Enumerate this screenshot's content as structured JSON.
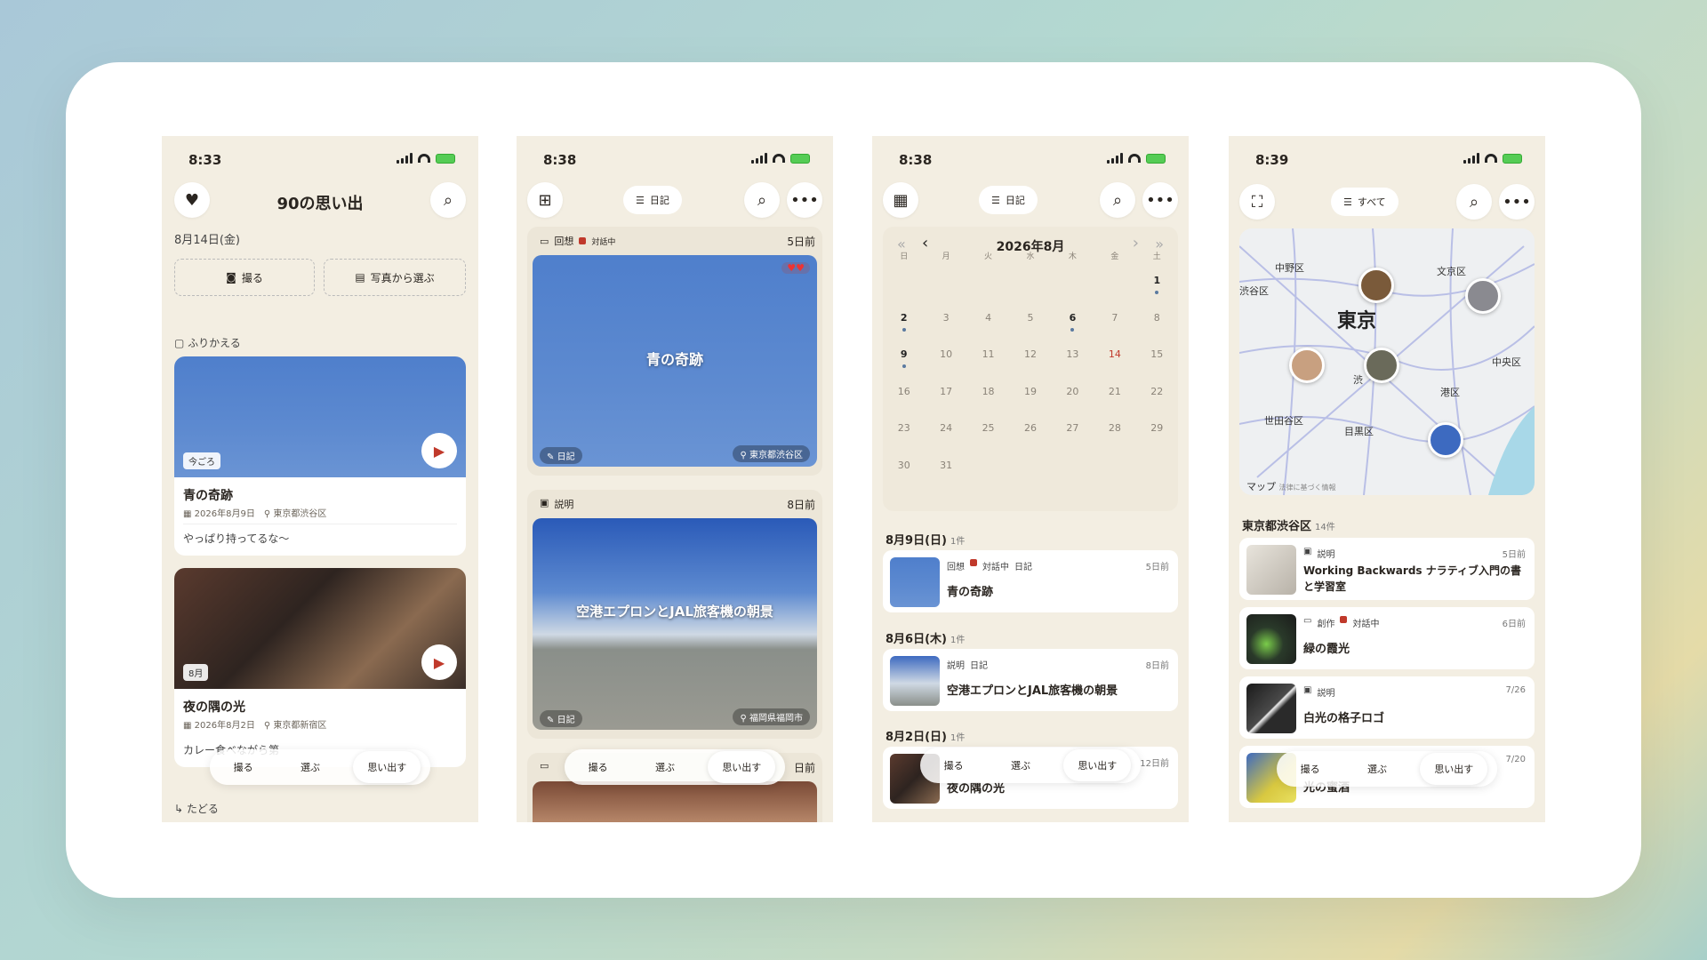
{
  "p1": {
    "time": "8:33",
    "title": "90の思い出",
    "date": "8月14日(金)",
    "btn_shoot": "撮る",
    "btn_pick": "写真から選ぶ",
    "section": "ふりかえる",
    "m1": {
      "badge": "今ごろ",
      "title": "青の奇跡",
      "date": "2026年8月9日",
      "loc": "東京都渋谷区",
      "note": "やっぱり持ってるな〜"
    },
    "m2": {
      "badge": "8月",
      "title": "夜の隅の光",
      "date": "2026年8月2日",
      "loc": "東京都新宿区",
      "note": "カレー食べながら第"
    },
    "footer": "たどる"
  },
  "tabs": {
    "shoot": "撮る",
    "pick": "選ぶ",
    "recall": "思い出す"
  },
  "p2": {
    "time": "8:38",
    "filter": "日記",
    "c1": {
      "tag1": "回想",
      "tag2": "対話中",
      "ago": "5日前",
      "title": "青の奇跡",
      "diary": "日記",
      "loc": "東京都渋谷区"
    },
    "c2": {
      "tag1": "説明",
      "ago": "8日前",
      "title": "空港エプロンとJAL旅客機の朝景",
      "diary": "日記",
      "loc": "福岡県福岡市"
    },
    "c3": {
      "ago": "日前"
    }
  },
  "p3": {
    "time": "8:38",
    "filter": "日記",
    "month": "2026年8月",
    "dow": [
      "日",
      "月",
      "火",
      "水",
      "木",
      "金",
      "土"
    ],
    "days": [
      "",
      "",
      "",
      "",
      "",
      "",
      "1",
      "2",
      "3",
      "4",
      "5",
      "6",
      "7",
      "8",
      "9",
      "10",
      "11",
      "12",
      "13",
      "14",
      "15",
      "16",
      "17",
      "18",
      "19",
      "20",
      "21",
      "22",
      "23",
      "24",
      "25",
      "26",
      "27",
      "28",
      "29",
      "30",
      "31"
    ],
    "g1": {
      "head": "8月9日(日)",
      "count": "1件",
      "t1": "回想",
      "t2": "対話中",
      "t3": "日記",
      "ago": "5日前",
      "title": "青の奇跡"
    },
    "g2": {
      "head": "8月6日(木)",
      "count": "1件",
      "t1": "説明",
      "t2": "日記",
      "ago": "8日前",
      "title": "空港エプロンとJAL旅客機の朝景"
    },
    "g3": {
      "head": "8月2日(日)",
      "count": "1件",
      "ago": "12日前",
      "title": "夜の隅の光"
    }
  },
  "p4": {
    "time": "8:39",
    "filter": "すべて",
    "map_city": "東京",
    "map_labels": [
      "中野区",
      "文京区",
      "渋谷区",
      "中央区",
      "港区",
      "世田谷区",
      "目黒区",
      "渋"
    ],
    "map_brand": "マップ",
    "map_legal": "法律に基づく情報",
    "section": "東京都渋谷区",
    "count": "14件",
    "rows": [
      {
        "tag": "説明",
        "ago": "5日前",
        "title": "Working Backwards ナラティブ入門の書と学習室"
      },
      {
        "tag": "創作",
        "tag2": "対話中",
        "ago": "6日前",
        "title": "緑の霞光"
      },
      {
        "tag": "説明",
        "ago": "7/26",
        "title": "白光の格子ロゴ"
      },
      {
        "tag": "",
        "ago": "7/20",
        "title": "光の蜜酒"
      }
    ]
  }
}
